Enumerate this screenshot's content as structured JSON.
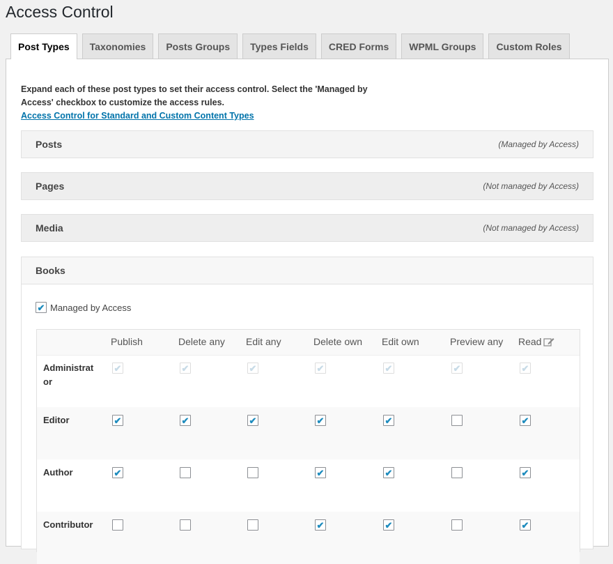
{
  "page": {
    "title": "Access Control"
  },
  "tabs": [
    {
      "label": "Post Types",
      "active": true
    },
    {
      "label": "Taxonomies"
    },
    {
      "label": "Posts Groups"
    },
    {
      "label": "Types Fields"
    },
    {
      "label": "CRED Forms"
    },
    {
      "label": "WPML Groups"
    },
    {
      "label": "Custom Roles"
    }
  ],
  "intro": {
    "text": "Expand each of these post types to set their access control. Select the 'Managed by Access' checkbox to customize the access rules.",
    "link": "Access Control for Standard and Custom Content Types"
  },
  "sections": [
    {
      "name": "Posts",
      "status": "(Managed by Access)"
    },
    {
      "name": "Pages",
      "status": "(Not managed by Access)"
    },
    {
      "name": "Media",
      "status": "(Not managed by Access)"
    },
    {
      "name": "Books",
      "status": ""
    }
  ],
  "books": {
    "managed_label": "Managed by Access",
    "managed_checked": true,
    "columns": [
      "Publish",
      "Delete any",
      "Edit any",
      "Delete own",
      "Edit own",
      "Preview any",
      "Read"
    ],
    "rows": [
      {
        "role": "Administrator",
        "values": [
          true,
          true,
          true,
          true,
          true,
          true,
          true
        ],
        "disabled": true
      },
      {
        "role": "Editor",
        "values": [
          true,
          true,
          true,
          true,
          true,
          false,
          true
        ],
        "disabled": false
      },
      {
        "role": "Author",
        "values": [
          true,
          false,
          false,
          true,
          true,
          false,
          true
        ],
        "disabled": false
      },
      {
        "role": "Contributor",
        "values": [
          false,
          false,
          false,
          true,
          true,
          false,
          true
        ],
        "disabled": false
      }
    ]
  },
  "colors": {
    "accent": "#0073aa",
    "check": "#1e8cbe"
  }
}
